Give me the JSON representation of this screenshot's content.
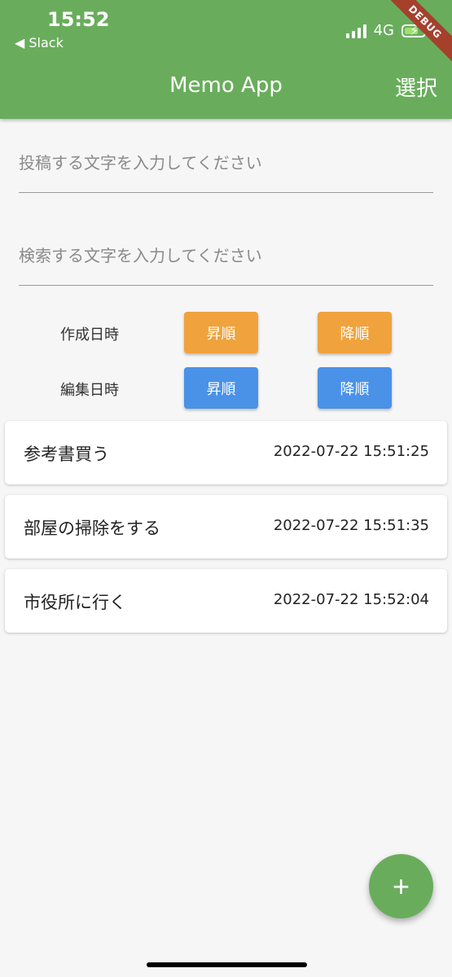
{
  "status_bar": {
    "time": "15:52",
    "back_app": "◀ Slack",
    "network": "4G"
  },
  "debug_banner": "DEBUG",
  "app_bar": {
    "title": "Memo App",
    "action": "選択"
  },
  "post_input": {
    "placeholder": "投稿する文字を入力してください",
    "value": ""
  },
  "search_input": {
    "placeholder": "検索する文字を入力してください",
    "value": ""
  },
  "sort": {
    "created": {
      "label": "作成日時",
      "asc": "昇順",
      "desc": "降順"
    },
    "edited": {
      "label": "編集日時",
      "asc": "昇順",
      "desc": "降順"
    }
  },
  "memos": [
    {
      "text": "参考書買う",
      "date": "2022-07-22 15:51:25"
    },
    {
      "text": "部屋の掃除をする",
      "date": "2022-07-22 15:51:35"
    },
    {
      "text": "市役所に行く",
      "date": "2022-07-22 15:52:04"
    }
  ],
  "fab": {
    "icon": "plus-icon",
    "glyph": "+"
  },
  "colors": {
    "primary": "#69ad5c",
    "created_sort": "#f0a23c",
    "edited_sort": "#4a92e8",
    "debug": "#a5402d"
  }
}
